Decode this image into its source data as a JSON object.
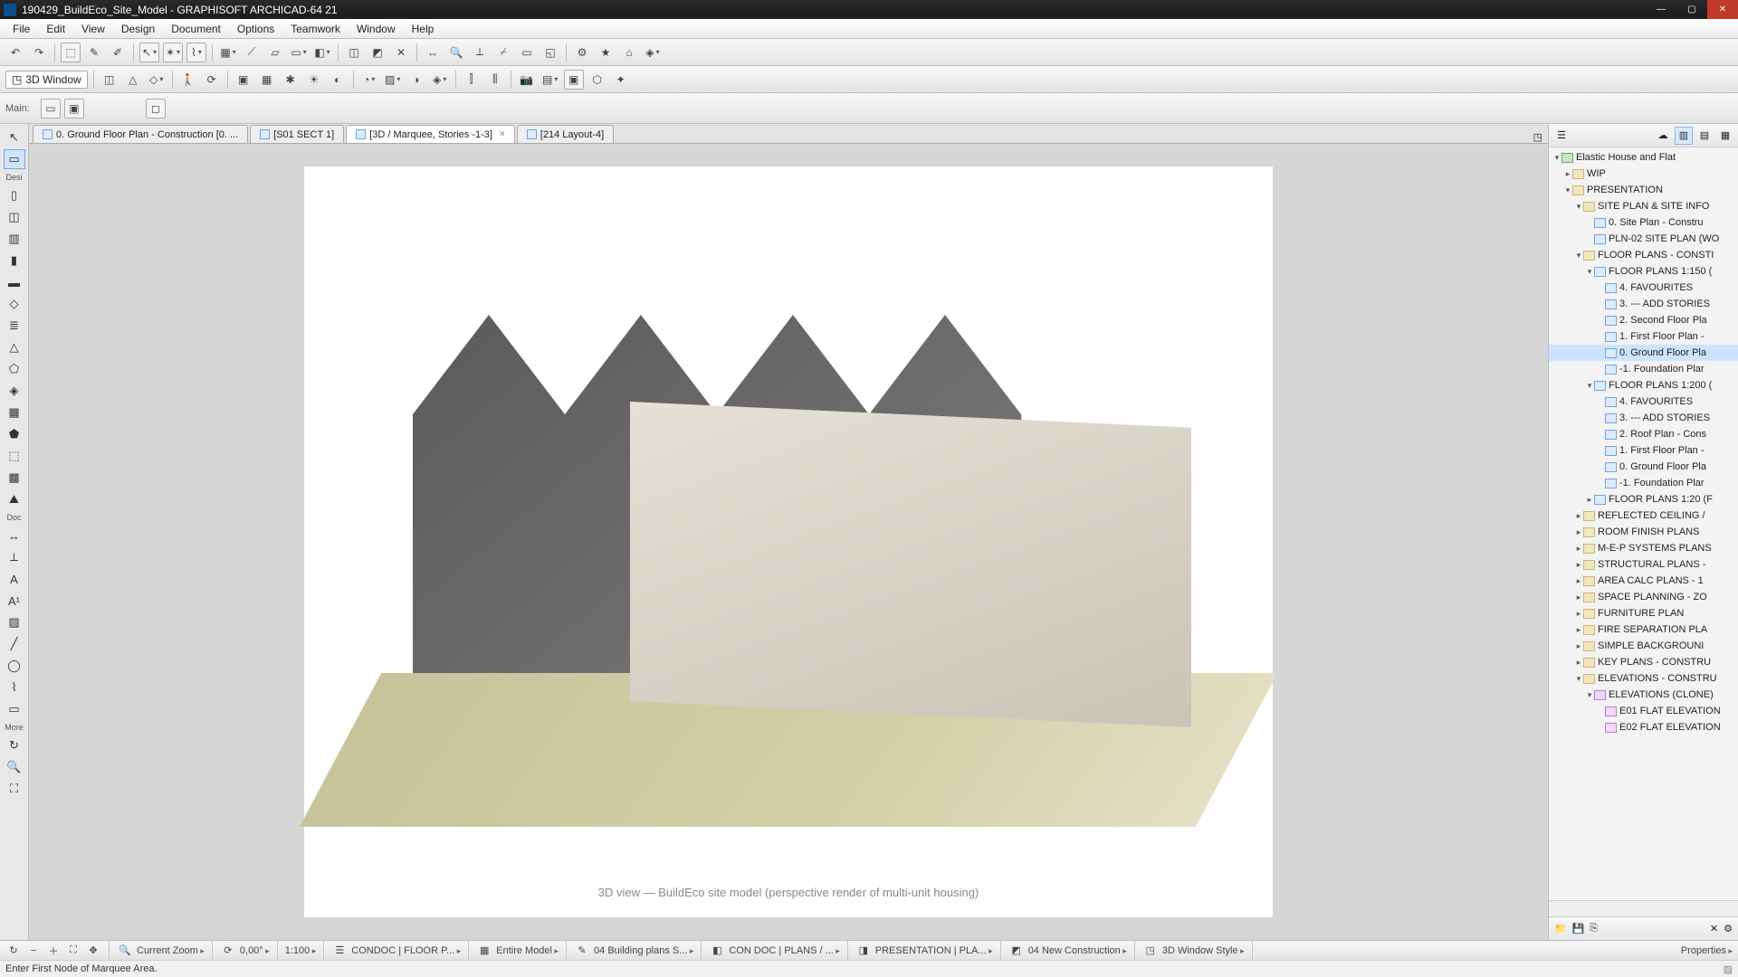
{
  "window": {
    "title": "190429_BuildEco_Site_Model - GRAPHISOFT ARCHICAD-64 21"
  },
  "menu": {
    "items": [
      "File",
      "Edit",
      "View",
      "Design",
      "Document",
      "Options",
      "Teamwork",
      "Window",
      "Help"
    ]
  },
  "toolbar3d": {
    "window_label": "3D Window"
  },
  "main_label": "Main:",
  "tabs": [
    {
      "label": "0. Ground Floor Plan - Construction [0. ...",
      "active": false,
      "closable": false
    },
    {
      "label": "[S01 SECT 1]",
      "active": false,
      "closable": false
    },
    {
      "label": "[3D / Marquee, Stories -1-3]",
      "active": true,
      "closable": true
    },
    {
      "label": "[214 Layout-4]",
      "active": false,
      "closable": false
    }
  ],
  "left_tools": {
    "group1_label": "Desi",
    "group2_label": "Doc",
    "group3_label": "More"
  },
  "navigator": {
    "root": "Elastic House and Flat",
    "tree": [
      {
        "depth": 0,
        "tw": "▾",
        "type": "root",
        "label": "Elastic House and Flat"
      },
      {
        "depth": 1,
        "tw": "▸",
        "type": "folder",
        "label": "WIP"
      },
      {
        "depth": 1,
        "tw": "▾",
        "type": "folder",
        "label": "PRESENTATION"
      },
      {
        "depth": 2,
        "tw": "▾",
        "type": "folder",
        "label": "SITE PLAN & SITE INFO"
      },
      {
        "depth": 3,
        "tw": "",
        "type": "plan",
        "label": "0. Site Plan - Constru"
      },
      {
        "depth": 3,
        "tw": "",
        "type": "plan",
        "label": "PLN-02 SITE PLAN (WO"
      },
      {
        "depth": 2,
        "tw": "▾",
        "type": "folder",
        "label": "FLOOR PLANS - CONSTI"
      },
      {
        "depth": 3,
        "tw": "▾",
        "type": "plan",
        "label": "FLOOR PLANS 1:150 ("
      },
      {
        "depth": 4,
        "tw": "",
        "type": "plan",
        "label": "4. FAVOURITES"
      },
      {
        "depth": 4,
        "tw": "",
        "type": "plan",
        "label": "3. --- ADD STORIES"
      },
      {
        "depth": 4,
        "tw": "",
        "type": "plan",
        "label": "2. Second Floor Pla"
      },
      {
        "depth": 4,
        "tw": "",
        "type": "plan",
        "label": "1. First Floor Plan -"
      },
      {
        "depth": 4,
        "tw": "",
        "type": "plan",
        "label": "0. Ground Floor Pla",
        "selected": true
      },
      {
        "depth": 4,
        "tw": "",
        "type": "plan",
        "label": "-1. Foundation Plar"
      },
      {
        "depth": 3,
        "tw": "▾",
        "type": "plan",
        "label": "FLOOR PLANS 1:200 ("
      },
      {
        "depth": 4,
        "tw": "",
        "type": "plan",
        "label": "4. FAVOURITES"
      },
      {
        "depth": 4,
        "tw": "",
        "type": "plan",
        "label": "3. --- ADD STORIES"
      },
      {
        "depth": 4,
        "tw": "",
        "type": "plan",
        "label": "2. Roof Plan - Cons"
      },
      {
        "depth": 4,
        "tw": "",
        "type": "plan",
        "label": "1. First Floor Plan -"
      },
      {
        "depth": 4,
        "tw": "",
        "type": "plan",
        "label": "0. Ground Floor Pla"
      },
      {
        "depth": 4,
        "tw": "",
        "type": "plan",
        "label": "-1. Foundation Plar"
      },
      {
        "depth": 3,
        "tw": "▸",
        "type": "plan",
        "label": "FLOOR PLANS 1:20 (F"
      },
      {
        "depth": 2,
        "tw": "▸",
        "type": "folder",
        "label": "REFLECTED CEILING /"
      },
      {
        "depth": 2,
        "tw": "▸",
        "type": "folder",
        "label": "ROOM FINISH PLANS"
      },
      {
        "depth": 2,
        "tw": "▸",
        "type": "folder",
        "label": "M-E-P SYSTEMS PLANS"
      },
      {
        "depth": 2,
        "tw": "▸",
        "type": "folder",
        "label": "STRUCTURAL PLANS -"
      },
      {
        "depth": 2,
        "tw": "▸",
        "type": "folder",
        "label": "AREA CALC PLANS - 1"
      },
      {
        "depth": 2,
        "tw": "▸",
        "type": "folder",
        "label": "SPACE PLANNING - ZO"
      },
      {
        "depth": 2,
        "tw": "▸",
        "type": "folder",
        "label": "FURNITURE PLAN"
      },
      {
        "depth": 2,
        "tw": "▸",
        "type": "folder",
        "label": "FIRE SEPARATION PLA"
      },
      {
        "depth": 2,
        "tw": "▸",
        "type": "folder",
        "label": "SIMPLE BACKGROUNI"
      },
      {
        "depth": 2,
        "tw": "▸",
        "type": "folder",
        "label": "KEY PLANS - CONSTRU"
      },
      {
        "depth": 2,
        "tw": "▾",
        "type": "folder",
        "label": "ELEVATIONS - CONSTRU"
      },
      {
        "depth": 3,
        "tw": "▾",
        "type": "elev",
        "label": "ELEVATIONS (CLONE)"
      },
      {
        "depth": 4,
        "tw": "",
        "type": "elev",
        "label": "E01 FLAT ELEVATION"
      },
      {
        "depth": 4,
        "tw": "",
        "type": "elev",
        "label": "E02 FLAT ELEVATION"
      }
    ]
  },
  "statusbar": {
    "zoom_label": "Current Zoom",
    "angle": "0,00°",
    "scale": "1:100",
    "layer_combo": "CONDOC | FLOOR P...",
    "model_view": "Entire Model",
    "pen_set": "04 Building plans S...",
    "mvo": "CON DOC | PLANS / ...",
    "gdl": "PRESENTATION | PLA...",
    "reno": "04 New Construction",
    "style3d": "3D Window Style",
    "properties": "Properties"
  },
  "hint": "Enter First Node of Marquee Area.",
  "viewport_note": "3D view — BuildEco site model (perspective render of multi-unit housing)"
}
